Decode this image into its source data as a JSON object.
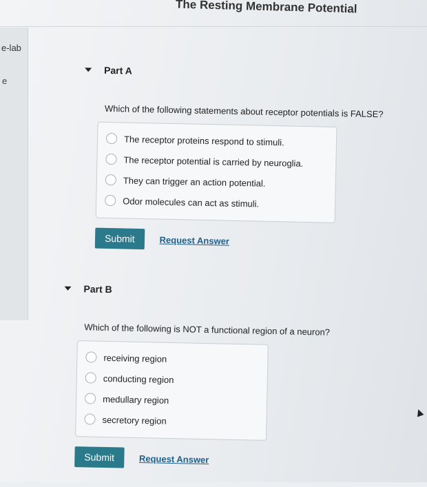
{
  "header": {
    "title": "The Resting Membrane Potential"
  },
  "sidebar": {
    "lab_label": "e-lab",
    "e_label": "e"
  },
  "partA": {
    "label": "Part A",
    "question": "Which of the following statements about receptor potentials is FALSE?",
    "options": [
      "The receptor proteins respond to stimuli.",
      "The receptor potential is carried by neuroglia.",
      "They can trigger an action potential.",
      "Odor molecules can act as stimuli."
    ],
    "submit_label": "Submit",
    "request_label": "Request Answer"
  },
  "partB": {
    "label": "Part B",
    "question": "Which of the following is NOT a functional region of a neuron?",
    "options": [
      "receiving region",
      "conducting region",
      "medullary region",
      "secretory region"
    ],
    "submit_label": "Submit",
    "request_label": "Request Answer"
  }
}
